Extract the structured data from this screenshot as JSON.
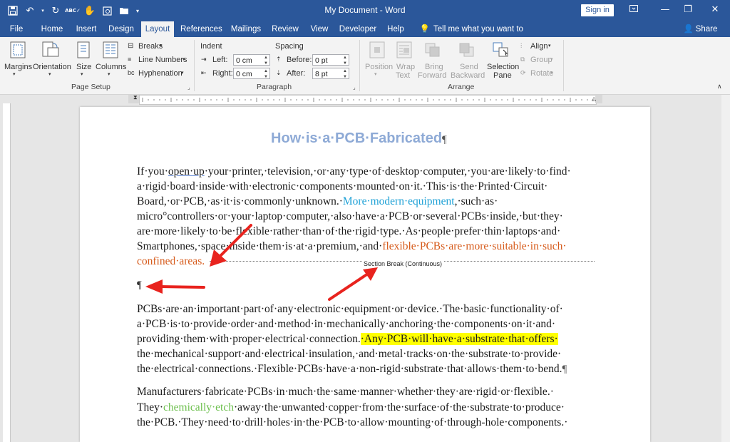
{
  "window": {
    "title": "My Document - Word",
    "sign_in": "Sign in",
    "share": "Share"
  },
  "tabs": [
    "File",
    "Home",
    "Insert",
    "Design",
    "Layout",
    "References",
    "Mailings",
    "Review",
    "View",
    "Developer",
    "Help"
  ],
  "active_tab": "Layout",
  "tell_me": "Tell me what you want to do",
  "ribbon": {
    "page_setup": {
      "label": "Page Setup",
      "margins": "Margins",
      "orientation": "Orientation",
      "size": "Size",
      "columns": "Columns",
      "breaks": "Breaks",
      "line_numbers": "Line Numbers",
      "hyphenation": "Hyphenation"
    },
    "indent": {
      "label": "Indent",
      "left_label": "Left:",
      "left_value": "0 cm",
      "right_label": "Right:",
      "right_value": "0 cm"
    },
    "spacing": {
      "label": "Spacing",
      "before_label": "Before:",
      "before_value": "0 pt",
      "after_label": "After:",
      "after_value": "8 pt"
    },
    "paragraph_label": "Paragraph",
    "arrange": {
      "label": "Arrange",
      "position": "Position",
      "wrap_text_1": "Wrap",
      "wrap_text_2": "Text",
      "bring_forward_1": "Bring",
      "bring_forward_2": "Forward",
      "send_backward_1": "Send",
      "send_backward_2": "Backward",
      "selection_pane_1": "Selection",
      "selection_pane_2": "Pane",
      "align": "Align",
      "group": "Group",
      "rotate": "Rotate"
    }
  },
  "document": {
    "heading": "How·is·a·PCB·Fabricated",
    "para1": {
      "l1_a": "If·you·",
      "l1_b": "open·up",
      "l1_c": "·your·printer,·television,·or·any·type·of·desktop·computer,·you·are·likely·to·find·",
      "l2": "a·rigid·board·inside·with·electronic·components·mounted·on·it.·This·is·the·Printed·Circuit·",
      "l3_a": "Board,·or·PCB,·as·it·is·commonly·unknown.·",
      "l3_b": "More·modern·equipment",
      "l3_c": ",·such·as·",
      "l4": "micro°controllers·or·your·laptop·computer,·also·have·a·PCB·or·several·PCBs·inside,·but·they·",
      "l5": "are·more·likely·to·be·flexible·rather·than·of·the·rigid·type.·As·people·prefer·thin·laptops·and·",
      "l6_a": "Smartphones,·space·inside·them·is·at·a·premium,·and·",
      "l6_b": "flexible·PCBs·are·more·suitable·in·such·",
      "l7": "confined·areas."
    },
    "section_break": "Section Break (Continuous)",
    "pilcrow": "¶",
    "para2": {
      "l1": "PCBs·are·an·important·part·of·any·electronic·equipment·or·device.·The·basic·functionality·of·",
      "l2": "a·PCB·is·to·provide·order·and·method·in·mechanically·anchoring·the·components·on·it·and·",
      "l3_a": "providing·them·with·proper·electrical·connection.",
      "l3_b": "·Any·PCB·will·have·a·substrate·that·offers·",
      "l4": "the·mechanical·support·and·electrical·insulation,·and·metal·tracks·on·the·substrate·to·provide·",
      "l5": "the·electrical·connections.·Flexible·PCBs·have·a·non-rigid·substrate·that·allows·them·to·bend."
    },
    "para3": {
      "l1": "Manufacturers·fabricate·PCBs·in·much·the·same·manner·whether·they·are·rigid·or·flexible.·",
      "l2_a": "They·",
      "l2_b": "chemically·etch",
      "l2_c": "·away·the·unwanted·copper·from·the·surface·of·the·substrate·to·produce·",
      "l3": "the·PCB.·They·need·to·drill·holes·in·the·PCB·to·allow·mounting·of·through-hole·components.·"
    }
  },
  "colors": {
    "title_bar": "#2b579a",
    "heading": "#8eaad6",
    "blue_text": "#1ea1d6",
    "orange_text": "#d65a1a",
    "green_text": "#6ec04f",
    "highlight": "#ffff00",
    "arrow": "#e8231e"
  },
  "icons": [
    "save-icon",
    "undo-icon",
    "redo-icon",
    "spelling-icon",
    "touch-mode-icon",
    "print-preview-icon",
    "open-folder-icon",
    "lightbulb-icon",
    "person-icon"
  ]
}
